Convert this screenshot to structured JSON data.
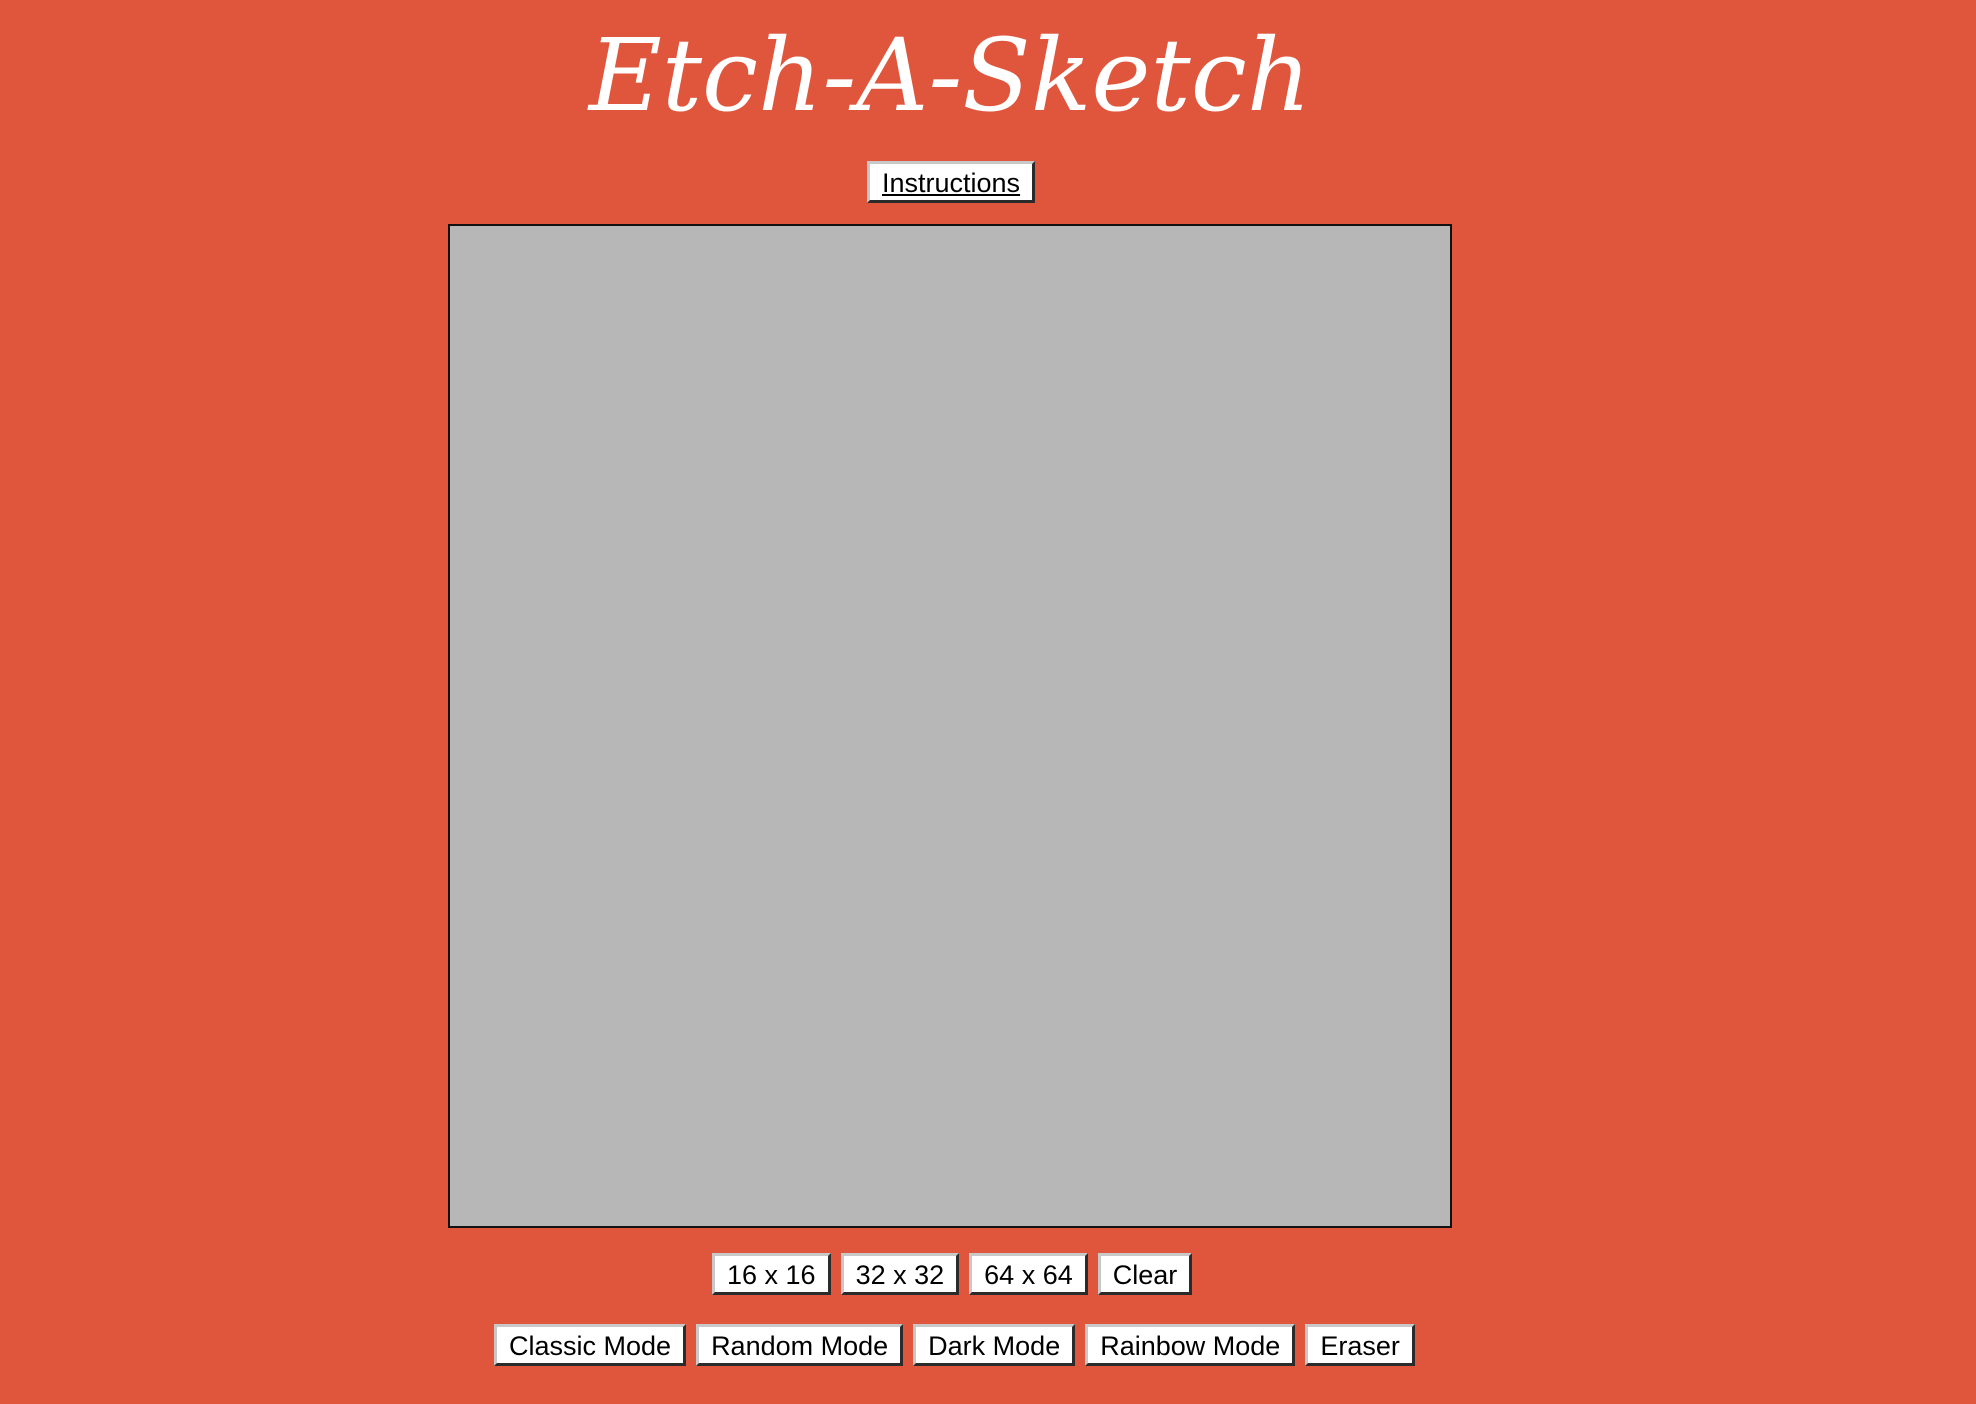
{
  "app": {
    "title": "Etch-A-Sketch"
  },
  "header": {
    "instructions_label": "Instructions"
  },
  "grid_controls": {
    "buttons": [
      {
        "label": "16 x 16"
      },
      {
        "label": "32 x 32"
      },
      {
        "label": "64 x 64"
      },
      {
        "label": "Clear"
      }
    ]
  },
  "mode_controls": {
    "buttons": [
      {
        "label": "Classic Mode"
      },
      {
        "label": "Random Mode"
      },
      {
        "label": "Dark Mode"
      },
      {
        "label": "Rainbow Mode"
      },
      {
        "label": "Eraser"
      }
    ]
  },
  "colors": {
    "background": "#e0563d",
    "canvas": "#b7b7b7",
    "title_text": "#ffffff"
  }
}
